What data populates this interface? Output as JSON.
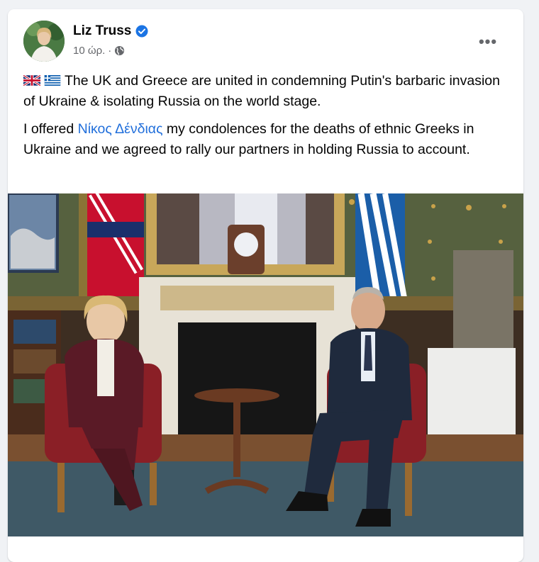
{
  "post": {
    "author": "Liz Truss",
    "time": "10 ώρ.",
    "separator": "·",
    "more_label": "•••",
    "flags": [
      "uk-flag-icon",
      "greece-flag-icon"
    ],
    "paragraph1": "The UK and Greece are united in condemning Putin's barbaric invasion of Ukraine & isolating Russia on the world stage.",
    "paragraph2_before": "I offered ",
    "paragraph2_mention": "Νίκος Δένδιας",
    "paragraph2_after": " my condolences for the deaths of ethnic Greeks in Ukraine and we agreed to rally our partners in holding Russia to account."
  },
  "colors": {
    "background": "#f0f2f5",
    "card": "#ffffff",
    "mention": "#216fdb",
    "secondary_text": "#65676b",
    "verified": "#1b74e4"
  }
}
